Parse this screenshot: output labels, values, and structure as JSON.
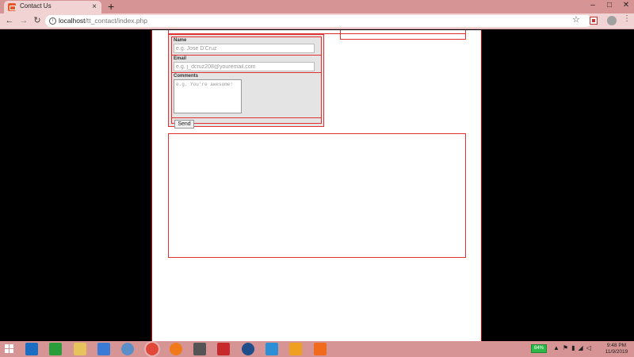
{
  "browser": {
    "tab_title": "Contact Us",
    "new_tab": "+",
    "url_host": "localhost",
    "url_path": "/tt_contact/index.php",
    "window_controls": [
      "–",
      "□",
      "✕"
    ]
  },
  "form": {
    "name_label": "Name",
    "name_placeholder": "e.g. Jose D'Cruz",
    "email_label": "Email",
    "email_placeholder": "e.g. j_dcruz208@youremail.com",
    "comments_label": "Comments",
    "comments_placeholder": "e.g. You're awesome!",
    "send_label": "Send"
  },
  "taskbar": {
    "battery": "84%",
    "time": "9:48 PM",
    "date": "11/9/2019",
    "apps": [
      {
        "icon": "ie-icon",
        "color": "#1b6ec2"
      },
      {
        "icon": "store-icon",
        "color": "#2a9d3a"
      },
      {
        "icon": "explorer-icon",
        "color": "#e8c25a"
      },
      {
        "icon": "remote-desktop-icon",
        "color": "#3a7bd5"
      },
      {
        "icon": "network-icon",
        "color": "#5b8fc7"
      },
      {
        "icon": "chrome-icon",
        "color": "#e0483a"
      },
      {
        "icon": "firefox-icon",
        "color": "#f07a1a"
      },
      {
        "icon": "terminal-icon",
        "color": "#555555"
      },
      {
        "icon": "filezilla-icon",
        "color": "#c62a2a"
      },
      {
        "icon": "vpn-icon",
        "color": "#1f4e8a"
      },
      {
        "icon": "notepad-icon",
        "color": "#2d8fd5"
      },
      {
        "icon": "media-player-icon",
        "color": "#f0a020"
      },
      {
        "icon": "xampp-icon",
        "color": "#f26b1c"
      }
    ]
  }
}
